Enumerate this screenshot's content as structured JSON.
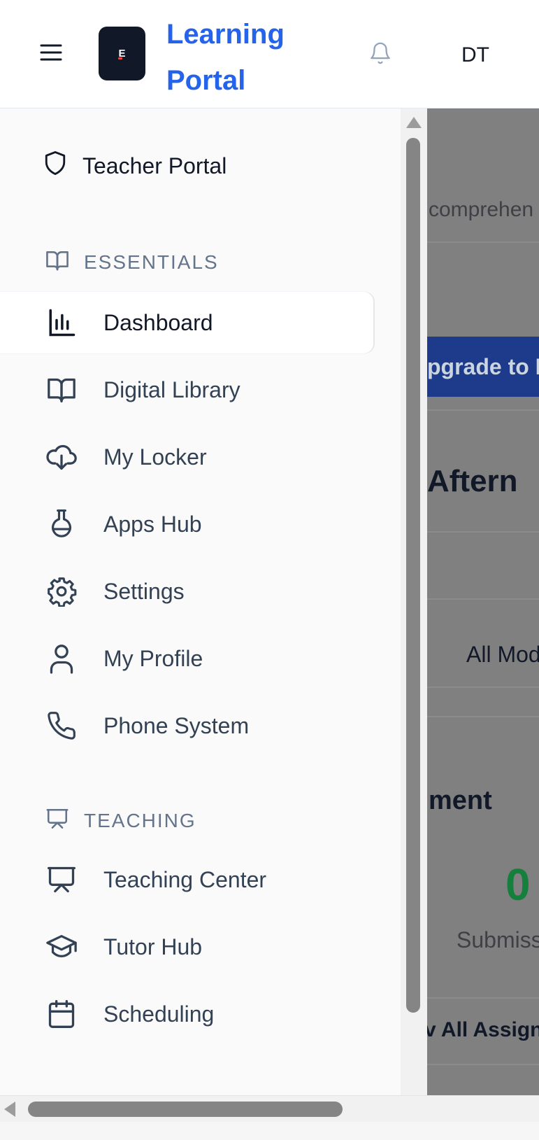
{
  "header": {
    "brand_line1": "Learning",
    "brand_line2": "Portal",
    "logo_letter": "E",
    "avatar_initials": "DT"
  },
  "sidebar": {
    "portal_title": "Teacher Portal",
    "sections": [
      {
        "label": "ESSENTIALS",
        "icon": "book-open-icon",
        "items": [
          {
            "label": "Dashboard",
            "icon": "bar-chart-icon",
            "active": true
          },
          {
            "label": "Digital Library",
            "icon": "book-open-icon"
          },
          {
            "label": "My Locker",
            "icon": "cloud-download-icon"
          },
          {
            "label": "Apps Hub",
            "icon": "flask-icon"
          },
          {
            "label": "Settings",
            "icon": "gear-icon"
          },
          {
            "label": "My Profile",
            "icon": "user-icon"
          },
          {
            "label": "Phone System",
            "icon": "phone-icon"
          }
        ]
      },
      {
        "label": "TEACHING",
        "icon": "presentation-icon",
        "items": [
          {
            "label": "Teaching Center",
            "icon": "presentation-icon"
          },
          {
            "label": "Tutor Hub",
            "icon": "graduation-cap-icon"
          },
          {
            "label": "Scheduling",
            "icon": "calendar-icon"
          }
        ]
      }
    ]
  },
  "background_page": {
    "snippet_1": "comprehen",
    "cta_text": "pgrade to I",
    "greeting": "Aftern",
    "filter": "All Mod",
    "section_title": "ment",
    "stat_value": "0",
    "stat_label": "Submiss",
    "link": "v All Assign"
  },
  "colors": {
    "brand": "#2563eb",
    "logo_bg": "#111827",
    "overlay": "#808080",
    "cta_bg": "#1e3a8a",
    "stat_green": "#15803d",
    "muted_text": "#64748b"
  }
}
